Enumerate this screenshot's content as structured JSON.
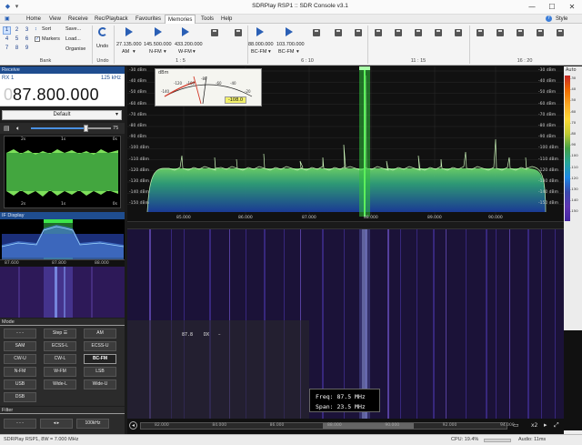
{
  "window": {
    "title": "SDRPlay RSP1 :: SDR Console v3.1",
    "style_label": "Style",
    "minimize": "—",
    "maximize": "☐",
    "close": "✕"
  },
  "menu": {
    "items": [
      "Home",
      "View",
      "Receive",
      "Rec/Playback",
      "Favourites",
      "Memories",
      "Tools",
      "Help"
    ],
    "active": "Memories"
  },
  "ribbon": {
    "bank_numbers": [
      "1",
      "2",
      "3",
      "4",
      "5",
      "6",
      "7",
      "8",
      "9"
    ],
    "sort_label": "Sort",
    "markers_label": "Markers",
    "markers_checked": true,
    "save_label": "Save...",
    "load_label": "Load...",
    "organise_label": "Organise",
    "undo_label": "Undo",
    "groups": [
      "Bank",
      "Undo",
      "1 : 5",
      "6 : 10",
      "11 : 15",
      "16 : 20"
    ],
    "memories": [
      {
        "freq": "27.135.000",
        "mode": "AM"
      },
      {
        "freq": "145.500.000",
        "mode": "N-FM"
      },
      {
        "freq": "433.200.000",
        "mode": "W-FM"
      },
      {
        "freq": "88.000.000",
        "mode": "BC-FM"
      },
      {
        "freq": "103.700.000",
        "mode": "BC-FM"
      }
    ]
  },
  "receive": {
    "header": "Receive",
    "rx_label": "RX 1",
    "bandwidth": "125 kHz",
    "frequency_dim": "0",
    "frequency": "87.800.000",
    "preset": "Default",
    "volume_value": "75",
    "time_labels": [
      "2s",
      "1s",
      "0s"
    ],
    "time_labels_bottom": [
      "2s",
      "1s",
      "0s"
    ]
  },
  "if_display": {
    "header": "IF Display",
    "ticks": [
      "87.600",
      "87.800",
      "88.000"
    ]
  },
  "mode": {
    "header": "Mode",
    "buttons": [
      [
        "- - -",
        "Step ☰",
        "AM"
      ],
      [
        "SAM",
        "ECSS-L",
        "ECSS-U"
      ],
      [
        "CW-U",
        "CW-L",
        "BC-FM"
      ],
      [
        "N-FM",
        "W-FM",
        "LSB"
      ],
      [
        "USB",
        "Wide-L",
        "Wide-U"
      ],
      [
        "DSB"
      ]
    ],
    "selected": "BC-FM"
  },
  "filter": {
    "header": "Filter",
    "buttons": [
      "- - -",
      "◂ ▸",
      "100kHz"
    ]
  },
  "spectrum": {
    "dbm_labels": [
      "-30 dBm",
      "-40 dBm",
      "-50 dBm",
      "-60 dBm",
      "-70 dBm",
      "-80 dBm",
      "-90 dBm",
      "-100 dBm",
      "-110 dBm",
      "-120 dBm",
      "-130 dBm",
      "-140 dBm",
      "-150 dBm"
    ],
    "freq_labels": [
      "85.000",
      "86.000",
      "87.000",
      "88.000",
      "89.000",
      "90.000"
    ],
    "meter_label": "dBm",
    "meter_value": "-108.0",
    "meter_scale": [
      "-140",
      "-120",
      "-100",
      "-80",
      "-60",
      "-40",
      "-20"
    ],
    "auto_label": "Auto"
  },
  "waterfall": {
    "marker_freq": "87.8",
    "marker_dx": "DX",
    "marker_dash": "–",
    "tooltip_freq": "Freq: 87.5 MHz",
    "tooltip_span": "Span: 23.5 MHz",
    "bottom_ticks": [
      "82.000",
      "84.000",
      "86.000",
      "88.000",
      "90.000",
      "92.000",
      "94.000"
    ],
    "zoom": "x2"
  },
  "right_scale": {
    "labels": [
      "-30",
      "-40",
      "-50",
      "-60",
      "-70",
      "-80",
      "-90",
      "-100",
      "-110",
      "-120",
      "-130",
      "-140",
      "-150"
    ]
  },
  "status": {
    "device": "SDRPlay RSP1, 8W = 7.000 MHz",
    "cpu": "CPU: 19.4%",
    "audio": "Audio: 11ms"
  },
  "colors": {
    "accent": "#2a5fb5",
    "signal_green": "#27c23a",
    "waterfall_bg": "#1b1238"
  }
}
